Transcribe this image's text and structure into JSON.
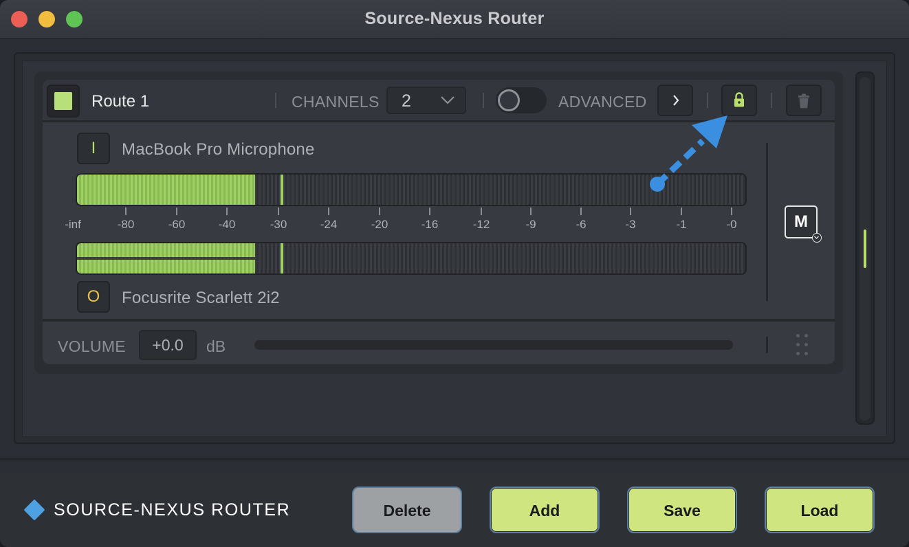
{
  "window": {
    "title": "Source-Nexus Router"
  },
  "route": {
    "name": "Route 1",
    "color": "#b8e07a",
    "channels_label": "CHANNELS",
    "channels_value": "2",
    "advanced_label": "ADVANCED",
    "advanced_enabled": false,
    "locked": true,
    "input_badge": "I",
    "input_device": "MacBook Pro Microphone",
    "output_badge": "O",
    "output_device": "Focusrite Scarlett 2i2",
    "meter_scale": [
      "-inf",
      "-80",
      "-60",
      "-40",
      "-30",
      "-24",
      "-20",
      "-16",
      "-12",
      "-9",
      "-6",
      "-3",
      "-1",
      "-0"
    ],
    "input_level_fraction": 0.265,
    "output_level_fraction": 0.265,
    "mute_label": "M",
    "volume_label": "VOLUME",
    "volume_value": "+0.0",
    "volume_unit": "dB"
  },
  "footer": {
    "brand": "SOURCE-NEXUS ROUTER",
    "delete_label": "Delete",
    "add_label": "Add",
    "save_label": "Save",
    "load_label": "Load"
  },
  "colors": {
    "accent_green": "#cfe57f",
    "meter_green": "#9fd063",
    "brand_blue": "#4fa0e0",
    "annotation_arrow": "#3a8fe0"
  },
  "icons": {
    "chevron": "chevron-down-icon",
    "advanced_expand": "chevron-right-icon",
    "lock": "lock-icon",
    "trash": "trash-icon",
    "grip": "drag-handle-icon",
    "brand": "diamond-icon"
  }
}
